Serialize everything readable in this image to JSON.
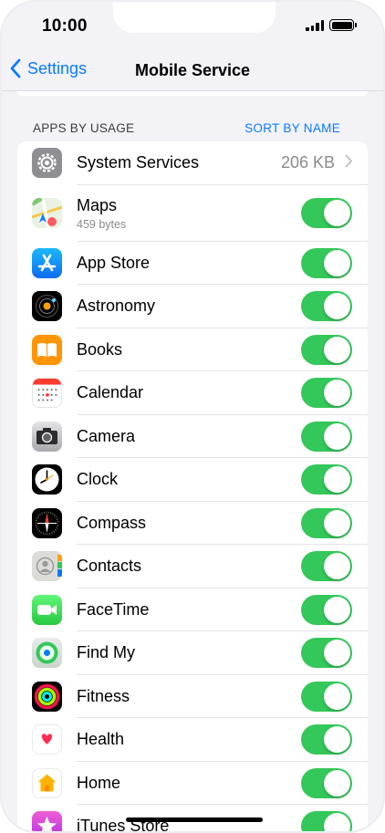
{
  "status_bar": {
    "time": "10:00"
  },
  "nav": {
    "back_label": "Settings",
    "title": "Mobile Service"
  },
  "section": {
    "title": "APPS BY USAGE",
    "sort_label": "SORT BY NAME"
  },
  "system_services": {
    "label": "System Services",
    "value": "206 KB"
  },
  "maps": {
    "label": "Maps",
    "sub": "459 bytes"
  },
  "apps": [
    {
      "label": "App Store"
    },
    {
      "label": "Astronomy"
    },
    {
      "label": "Books"
    },
    {
      "label": "Calendar"
    },
    {
      "label": "Camera"
    },
    {
      "label": "Clock"
    },
    {
      "label": "Compass"
    },
    {
      "label": "Contacts"
    },
    {
      "label": "FaceTime"
    },
    {
      "label": "Find My"
    },
    {
      "label": "Fitness"
    },
    {
      "label": "Health"
    },
    {
      "label": "Home"
    },
    {
      "label": "iTunes Store"
    }
  ],
  "colors": {
    "accent": "#0a7aff",
    "toggle_on": "#34c759",
    "background": "#f2f2f7"
  }
}
